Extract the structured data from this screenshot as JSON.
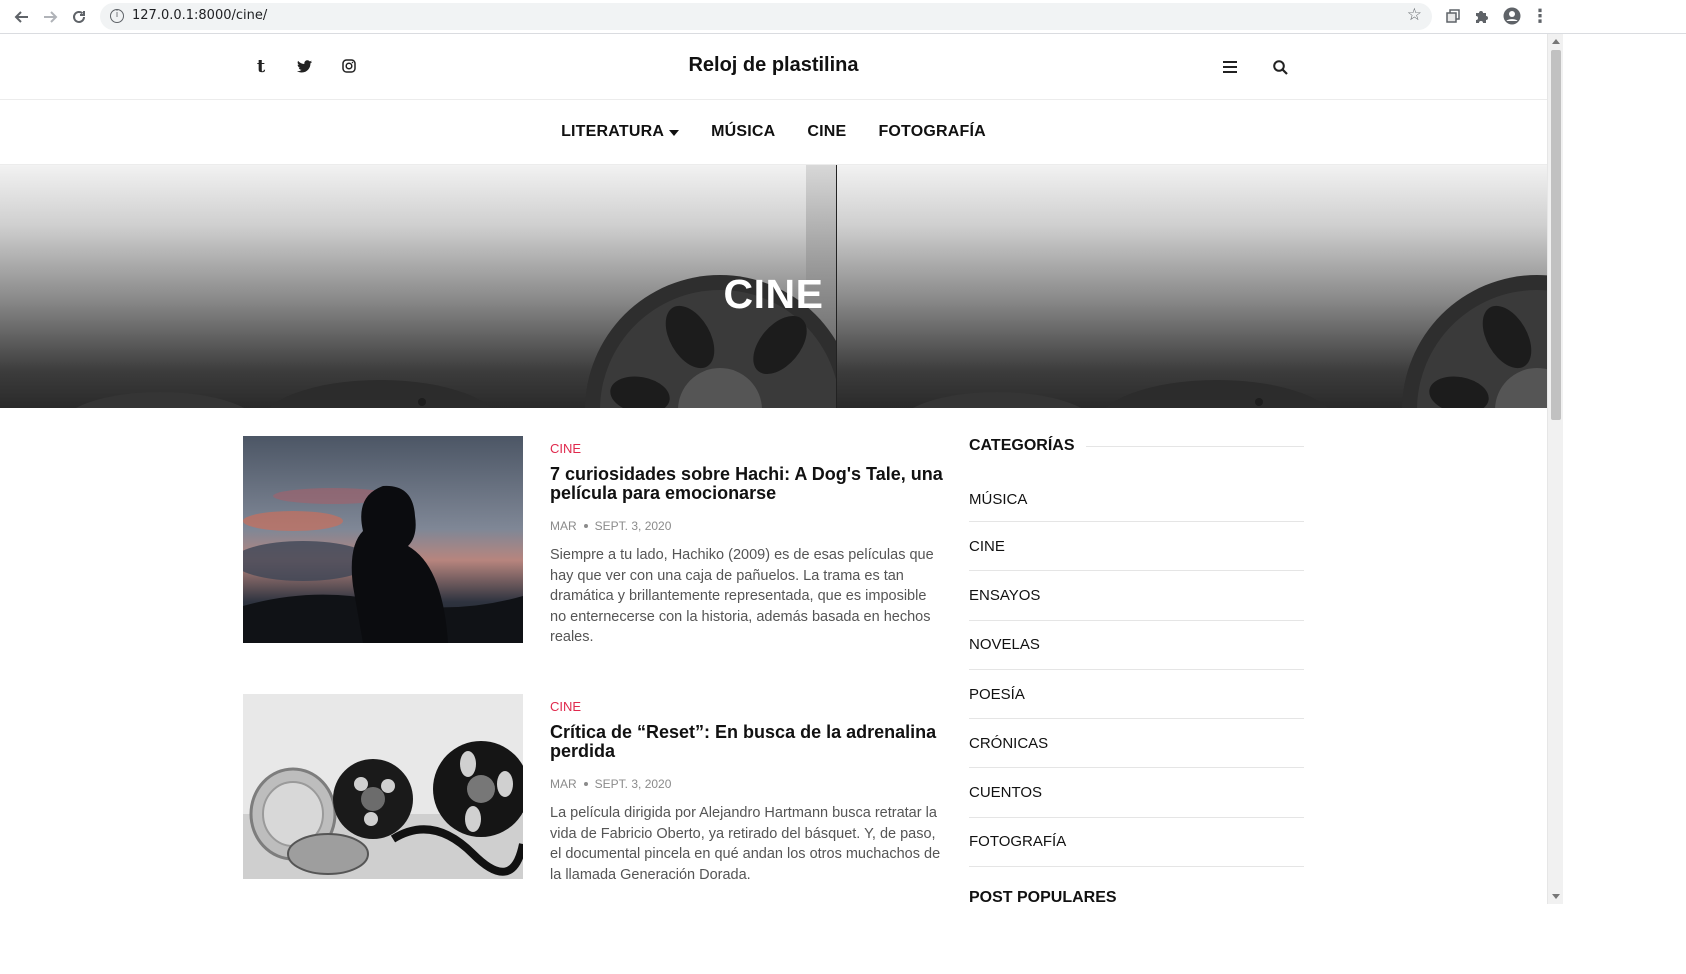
{
  "browser": {
    "url": "127.0.0.1:8000/cine/"
  },
  "header": {
    "site_title": "Reloj de plastilina",
    "social": [
      "tumblr-icon",
      "twitter-icon",
      "instagram-icon"
    ]
  },
  "nav": {
    "items": [
      {
        "label": "LITERATURA",
        "dropdown": true
      },
      {
        "label": "MÚSICA"
      },
      {
        "label": "CINE"
      },
      {
        "label": "FOTOGRAFÍA"
      }
    ]
  },
  "hero": {
    "title": "CINE"
  },
  "articles": [
    {
      "category": "CINE",
      "title": "7 curiosidades sobre Hachi: A Dog's Tale, una película para emocionarse",
      "author": "MAR",
      "date": "SEPT. 3, 2020",
      "excerpt": "Siempre a tu lado, Hachiko (2009) es de esas películas que hay que ver con una caja de pañuelos. La trama es tan dramática y brillantemente representada, que es imposible no enternecerse con la historia, además basada en hechos reales."
    },
    {
      "category": "CINE",
      "title": "Crítica de “Reset”: En busca de la adrenalina perdida",
      "author": "MAR",
      "date": "SEPT. 3, 2020",
      "excerpt": "La película dirigida por Alejandro Hartmann busca retratar la vida de Fabricio Oberto, ya retirado del básquet. Y, de paso, el documental pincela en qué andan los otros muchachos de la llamada Generación Dorada."
    }
  ],
  "sidebar": {
    "categories_title": "CATEGORÍAS",
    "categories": [
      "MÚSICA",
      "CINE",
      "ENSAYOS",
      "NOVELAS",
      "POESÍA",
      "CRÓNICAS",
      "CUENTOS",
      "FOTOGRAFÍA"
    ],
    "popular_title": "POST POPULARES"
  },
  "colors": {
    "accent": "#e0294d",
    "text": "#111111",
    "muted": "#8b8b8b"
  }
}
